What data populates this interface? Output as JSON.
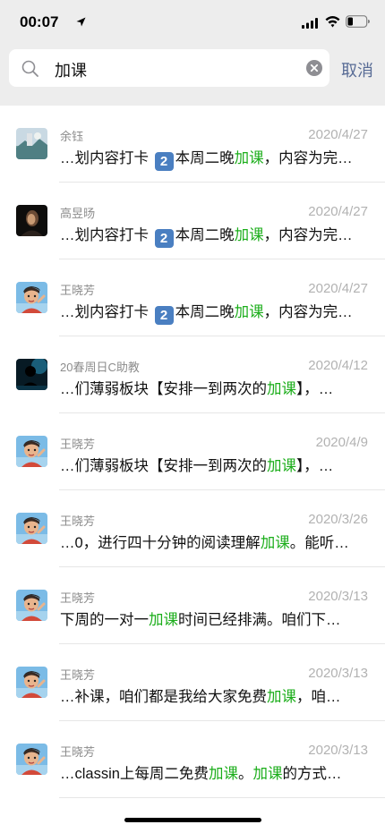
{
  "status_bar": {
    "time": "00:07"
  },
  "search": {
    "query": "加课",
    "cancel_label": "取消"
  },
  "results": [
    {
      "sender": "余钰",
      "date": "2020/4/27",
      "avatar": "landscape",
      "parts": [
        {
          "t": "…划内容打卡 "
        },
        {
          "e": "2"
        },
        {
          "t": "本周二晚"
        },
        {
          "h": "加课"
        },
        {
          "t": "，内容为完…"
        }
      ]
    },
    {
      "sender": "高昱旸",
      "date": "2020/4/27",
      "avatar": "dark-person",
      "parts": [
        {
          "t": "…划内容打卡 "
        },
        {
          "e": "2"
        },
        {
          "t": "本周二晚"
        },
        {
          "h": "加课"
        },
        {
          "t": "，内容为完…"
        }
      ]
    },
    {
      "sender": "王晓芳",
      "date": "2020/4/27",
      "avatar": "cartoon",
      "parts": [
        {
          "t": "…划内容打卡 "
        },
        {
          "e": "2"
        },
        {
          "t": "本周二晚"
        },
        {
          "h": "加课"
        },
        {
          "t": "，内容为完…"
        }
      ]
    },
    {
      "sender": "20春周日C助教",
      "date": "2020/4/12",
      "avatar": "silhouette",
      "parts": [
        {
          "t": "…们薄弱板块【安排一到两次的"
        },
        {
          "h": "加课"
        },
        {
          "t": "】，…"
        }
      ]
    },
    {
      "sender": "王晓芳",
      "date": "2020/4/9",
      "avatar": "cartoon",
      "parts": [
        {
          "t": "…们薄弱板块【安排一到两次的"
        },
        {
          "h": "加课"
        },
        {
          "t": "】，…"
        }
      ]
    },
    {
      "sender": "王晓芳",
      "date": "2020/3/26",
      "avatar": "cartoon",
      "parts": [
        {
          "t": "…0，进行四十分钟的阅读理解"
        },
        {
          "h": "加课"
        },
        {
          "t": "。能听…"
        }
      ]
    },
    {
      "sender": "王晓芳",
      "date": "2020/3/13",
      "avatar": "cartoon",
      "parts": [
        {
          "t": "下周的一对一"
        },
        {
          "h": "加课"
        },
        {
          "t": "时间已经排满。咱们下…"
        }
      ]
    },
    {
      "sender": "王晓芳",
      "date": "2020/3/13",
      "avatar": "cartoon",
      "parts": [
        {
          "t": "…补课，咱们都是我给大家免费"
        },
        {
          "h": "加课"
        },
        {
          "t": "，咱…"
        }
      ]
    },
    {
      "sender": "王晓芳",
      "date": "2020/3/13",
      "avatar": "cartoon",
      "parts": [
        {
          "t": "…classin上每周二免费"
        },
        {
          "h": "加课"
        },
        {
          "t": "。"
        },
        {
          "h": "加课"
        },
        {
          "t": "的方式…"
        }
      ]
    }
  ],
  "colors": {
    "highlight": "#1aad19",
    "cancel": "#576b95",
    "header_bg": "#ededed"
  }
}
